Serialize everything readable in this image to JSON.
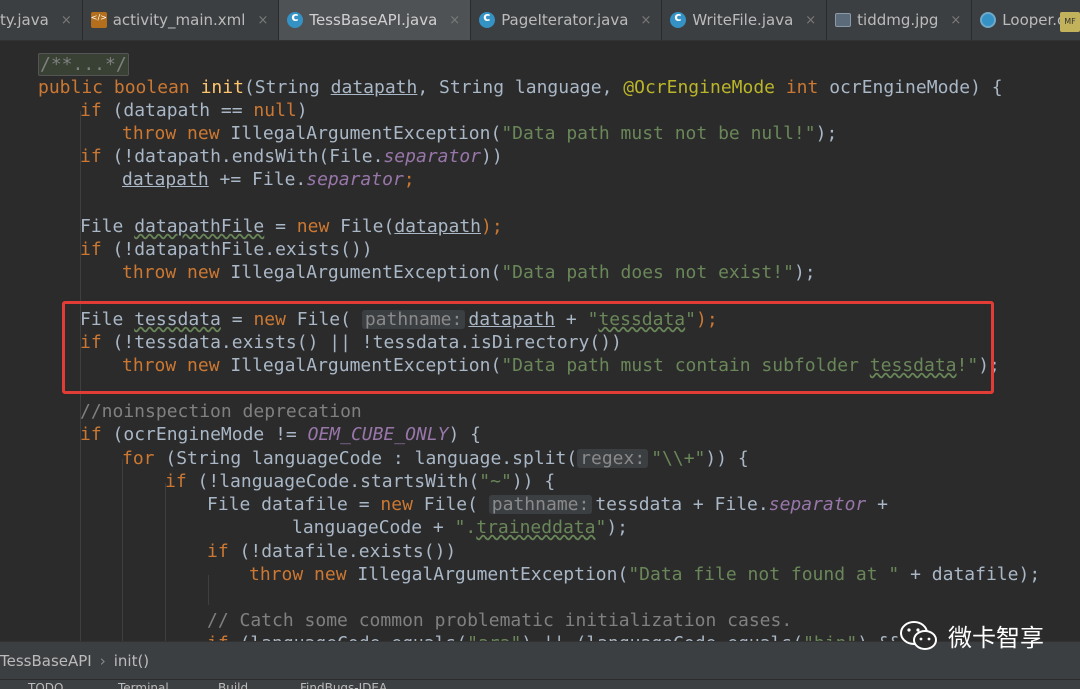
{
  "tabs": [
    {
      "label": "ty.java",
      "icon": "java-class-icon"
    },
    {
      "label": "activity_main.xml",
      "icon": "xml-file-icon"
    },
    {
      "label": "TessBaseAPI.java",
      "icon": "java-class-icon",
      "active": true
    },
    {
      "label": "PageIterator.java",
      "icon": "java-class-icon"
    },
    {
      "label": "WriteFile.java",
      "icon": "java-class-icon"
    },
    {
      "label": "tiddmg.jpg",
      "icon": "image-file-icon"
    },
    {
      "label": "Looper.class",
      "icon": "class-file-icon"
    }
  ],
  "tab_close_glyph": "×",
  "manifest_badge": "MF",
  "code": {
    "l1": [
      "/**...*/"
    ],
    "l2": [
      "public",
      "boolean",
      "init",
      "String",
      "datapath",
      "String language,",
      "@OcrEngineMode",
      "int",
      "ocrEngineMode) {"
    ],
    "l3": [
      "if",
      "(datapath ==",
      "null",
      ")"
    ],
    "l4": [
      "throw",
      "new",
      "IllegalArgumentException(",
      "\"Data path must not be null!\"",
      ");"
    ],
    "l5": [
      "if",
      "(!datapath.endsWith(File.",
      "separator",
      "))"
    ],
    "l6": [
      "datapath",
      "+= File.",
      "separator",
      ";"
    ],
    "l7": [
      "File",
      "datapathFile",
      "=",
      "new",
      "File(",
      "datapath",
      ");"
    ],
    "l8": [
      "if",
      "(!datapathFile.exists())"
    ],
    "l9": [
      "throw",
      "new",
      "IllegalArgumentException(",
      "\"Data path does not exist!\"",
      ");"
    ],
    "l10": [
      "File",
      "tessdata",
      "=",
      "new",
      "File(",
      "pathname:",
      "datapath",
      "+",
      "\"",
      "tessdata",
      "\"",
      ");"
    ],
    "l11": [
      "if",
      "(!tessdata.exists() || !tessdata.isDirectory())"
    ],
    "l12": [
      "throw",
      "new",
      "IllegalArgumentException(",
      "\"Data path must contain subfolder ",
      "tessdata",
      "!\"",
      ");"
    ],
    "l13": [
      "//noinspection deprecation"
    ],
    "l14": [
      "if",
      "(ocrEngineMode !=",
      "OEM_CUBE_ONLY",
      ") {"
    ],
    "l15": [
      "for",
      "(String languageCode : language.split(",
      "regex:",
      "\"\\\\+\"",
      ")) {"
    ],
    "l16": [
      "if",
      "(!languageCode.startsWith(",
      "\"~\"",
      ")) {"
    ],
    "l17": [
      "File datafile =",
      "new",
      "File(",
      "pathname:",
      "tessdata + File.",
      "separator",
      "+"
    ],
    "l18": [
      "languageCode +",
      "\".",
      "traineddata",
      "\"",
      ");"
    ],
    "l19": [
      "if",
      "(!datafile.exists())"
    ],
    "l20": [
      "throw",
      "new",
      "IllegalArgumentException(",
      "\"Data file not found at \"",
      "+ datafile);"
    ],
    "l21": [
      "// Catch some common problematic initialization cases."
    ],
    "l22": [
      "if",
      "(languageCode.equals(",
      "\"ara\"",
      ") || (languageCode.equals(",
      "\"hin\"",
      ") &&"
    ]
  },
  "breadcrumb": {
    "file": "TessBaseAPI",
    "sep": "›",
    "method": "init()"
  },
  "toolwindows": [
    "TODO",
    "Terminal",
    "Build",
    "FindBugs-IDEA"
  ],
  "watermark": {
    "text": "微卡智享",
    "icon": "wechat-icon"
  },
  "colors": {
    "keyword": "#cc7832",
    "string": "#6a8759",
    "highlight_box": "#e23c37",
    "background": "#2b2b2b"
  }
}
